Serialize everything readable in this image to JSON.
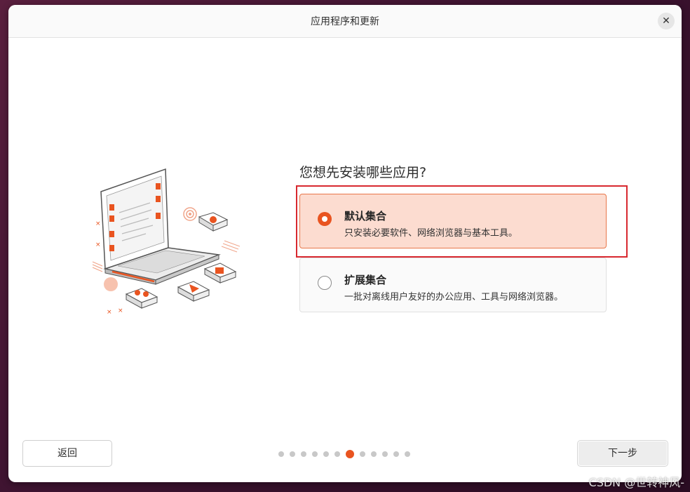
{
  "window": {
    "title": "应用程序和更新",
    "close_symbol": "✕"
  },
  "question": "您想先安装哪些应用?",
  "options": [
    {
      "title": "默认集合",
      "description": "只安装必要软件、网络浏览器与基本工具。",
      "selected": true
    },
    {
      "title": "扩展集合",
      "description": "一批对离线用户友好的办公应用、工具与网络浏览器。",
      "selected": false
    }
  ],
  "footer": {
    "back_label": "返回",
    "next_label": "下一步",
    "page_count": 12,
    "current_page": 7
  },
  "colors": {
    "accent": "#e95420",
    "selected_bg": "#fcdcd0",
    "highlight_box": "#d8282f"
  },
  "watermark": "CSDN @世转神风-"
}
